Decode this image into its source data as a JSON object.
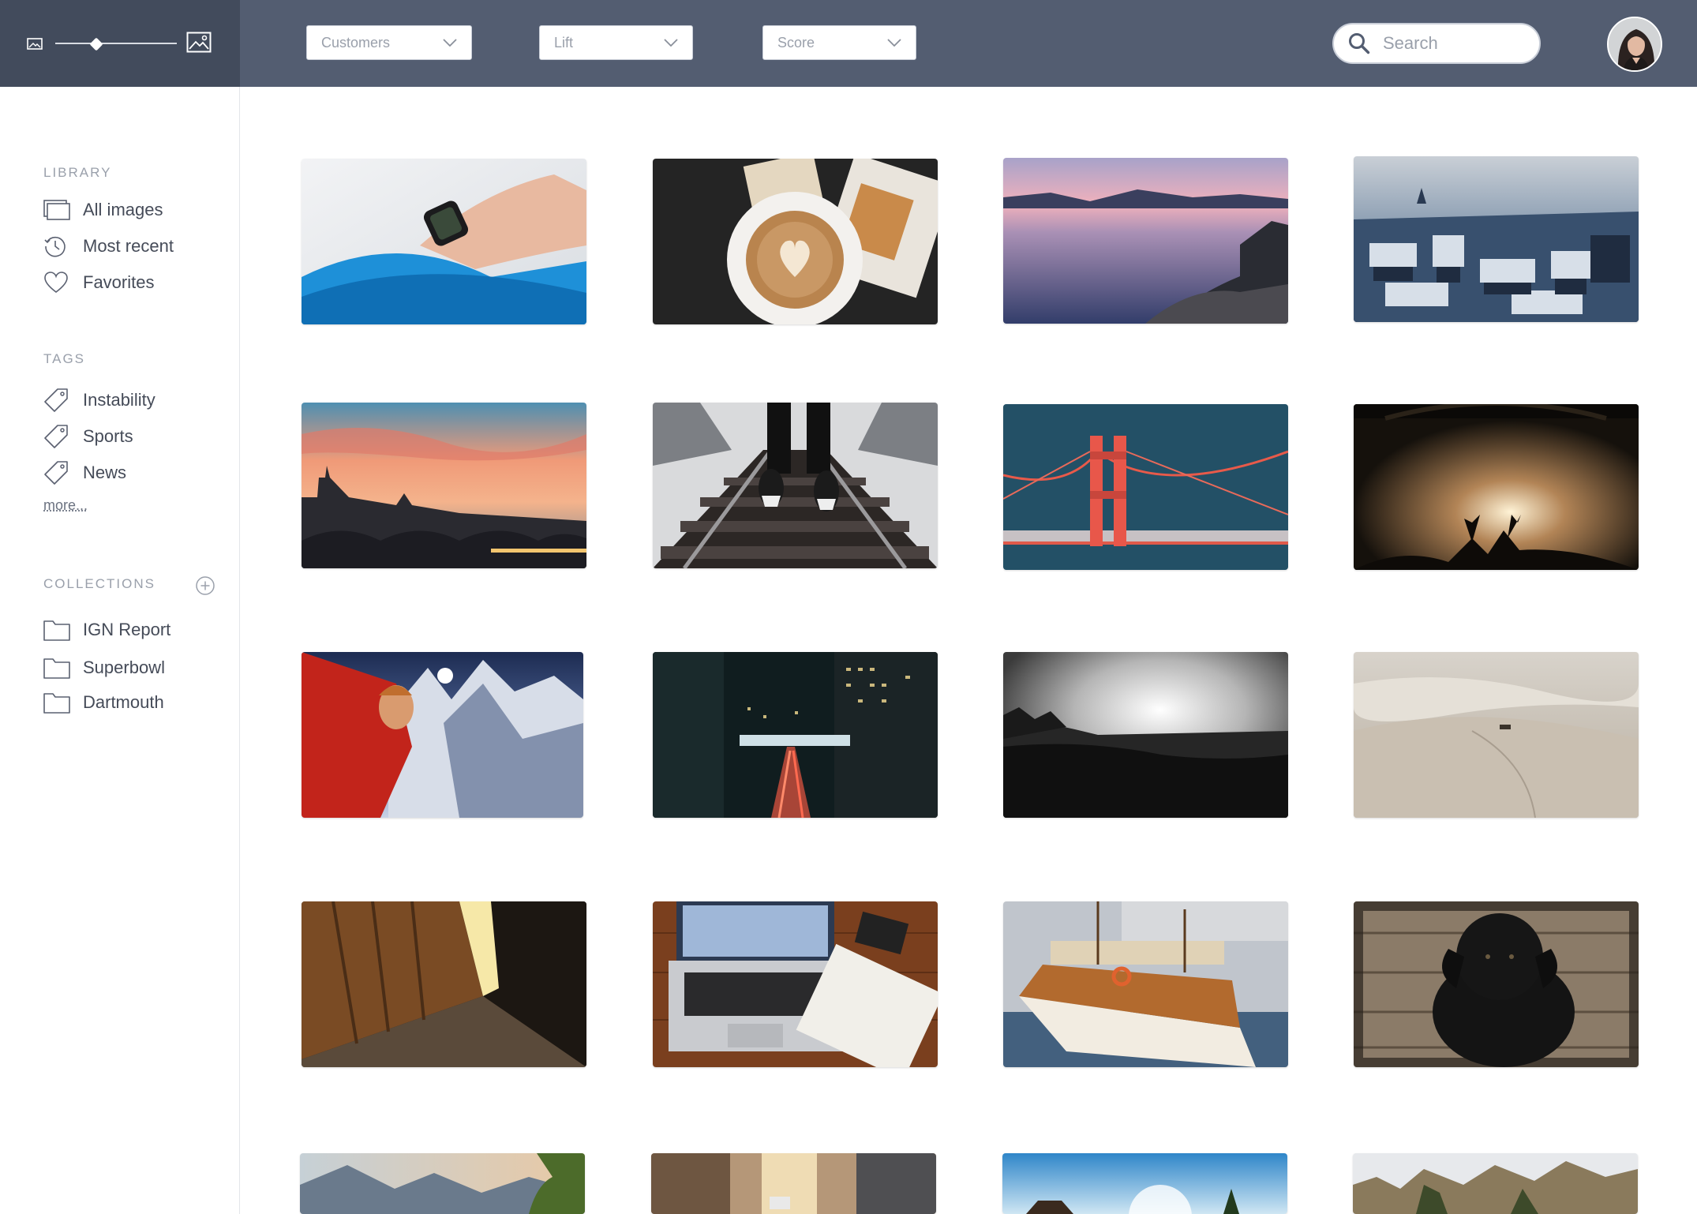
{
  "toolbar": {
    "filters": [
      {
        "label": "Customers"
      },
      {
        "label": "Lift"
      },
      {
        "label": "Score"
      }
    ],
    "search": {
      "placeholder": "Search"
    }
  },
  "sidebar": {
    "library": {
      "title": "LIBRARY",
      "items": [
        {
          "label": "All images",
          "icon": "gallery-icon"
        },
        {
          "label": "Most recent",
          "icon": "clock-icon"
        },
        {
          "label": "Favorites",
          "icon": "heart-icon"
        }
      ]
    },
    "tags": {
      "title": "TAGS",
      "items": [
        {
          "label": "Instability",
          "icon": "tag-icon"
        },
        {
          "label": "Sports",
          "icon": "tag-icon"
        },
        {
          "label": "News",
          "icon": "tag-icon"
        }
      ],
      "more_label": "more..."
    },
    "collections": {
      "title": "COLLECTIONS",
      "items": [
        {
          "label": "IGN Report",
          "icon": "folder-icon"
        },
        {
          "label": "Superbowl",
          "icon": "folder-icon"
        },
        {
          "label": "Dartmouth",
          "icon": "folder-icon"
        }
      ]
    }
  },
  "colors": {
    "topbar": "#535d71",
    "zoom_panel": "#424b5c",
    "sidebar_text": "#454b58",
    "section_title": "#9aa0ab"
  }
}
